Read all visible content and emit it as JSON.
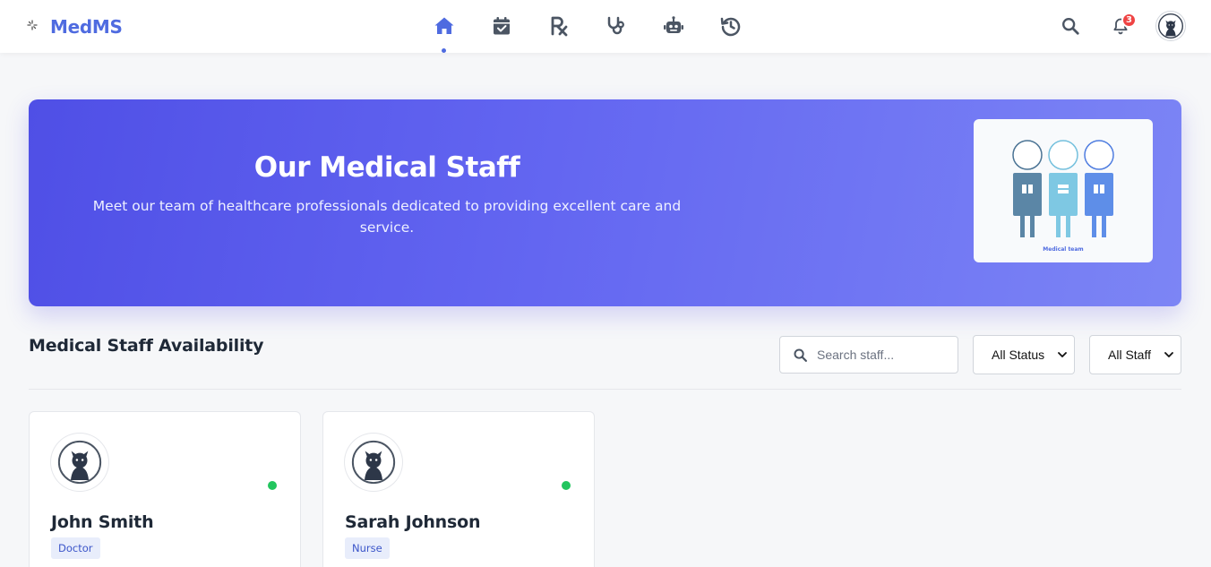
{
  "app": {
    "brand_name": "MedMS",
    "accent_color": "#4f6be0"
  },
  "nav": {
    "items": [
      {
        "icon": "home-icon",
        "active": true
      },
      {
        "icon": "calendar-check-icon",
        "active": false
      },
      {
        "icon": "prescription-icon",
        "active": false
      },
      {
        "icon": "stethoscope-icon",
        "active": false
      },
      {
        "icon": "robot-icon",
        "active": false
      },
      {
        "icon": "history-icon",
        "active": false
      }
    ]
  },
  "header_tools": {
    "search_icon": "search-icon",
    "notifications_count": "3",
    "avatar_icon": "cat-avatar-icon"
  },
  "hero": {
    "title": "Our Medical Staff",
    "subtitle": "Meet our team of healthcare professionals dedicated to providing excellent care and service.",
    "illustration_caption": "Medical team"
  },
  "staff_section": {
    "title": "Medical Staff Availability",
    "search_placeholder": "Search staff...",
    "status_filter": {
      "selected": "All Status"
    },
    "type_filter": {
      "selected": "All Staff"
    }
  },
  "staff": [
    {
      "name": "John Smith",
      "role": "Doctor",
      "status": "available",
      "status_color": "#22c55e"
    },
    {
      "name": "Sarah Johnson",
      "role": "Nurse",
      "status": "available",
      "status_color": "#22c55e"
    }
  ]
}
